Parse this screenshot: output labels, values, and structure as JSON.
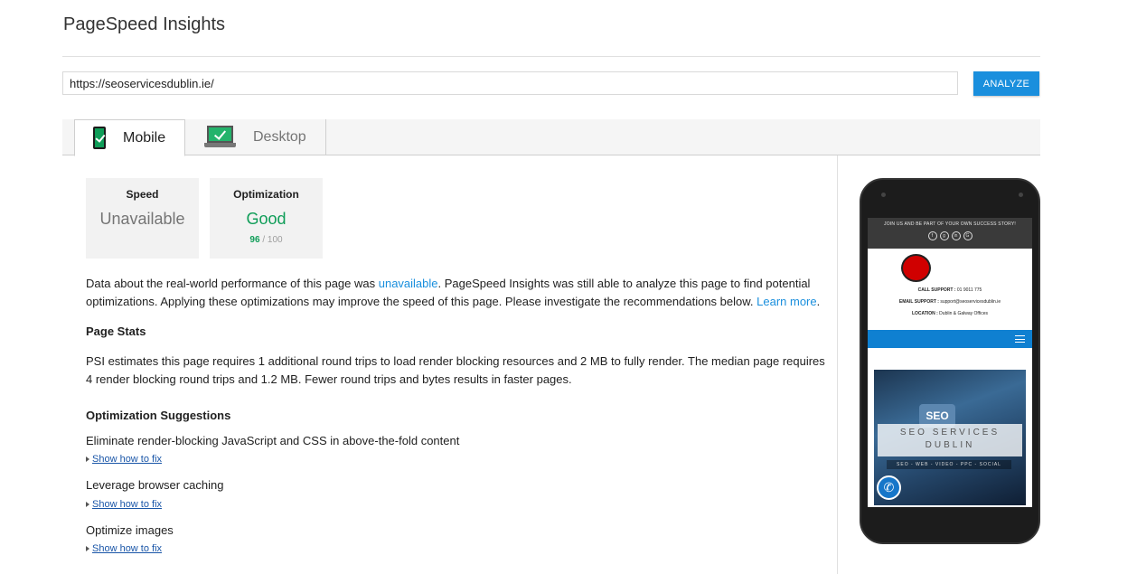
{
  "app": {
    "title": "PageSpeed Insights"
  },
  "search": {
    "url_value": "https://seoservicesdublin.ie/",
    "analyze_label": "ANALYZE"
  },
  "tabs": [
    {
      "label": "Mobile",
      "icon": "mobile-phone-check-icon",
      "active": true
    },
    {
      "label": "Desktop",
      "icon": "laptop-check-icon",
      "active": false
    }
  ],
  "scores": {
    "speed": {
      "title": "Speed",
      "value": "Unavailable"
    },
    "optimization": {
      "title": "Optimization",
      "value": "Good",
      "score": "96",
      "max": "/ 100"
    }
  },
  "summary": {
    "part1": "Data about the real-world performance of this page was ",
    "link_unavailable": "unavailable",
    "part2": ". PageSpeed Insights was still able to analyze this page to find potential optimizations. Applying these optimizations may improve the speed of this page. Please investigate the recommendations below. ",
    "link_learn_more": "Learn more",
    "part3": "."
  },
  "page_stats": {
    "heading": "Page Stats",
    "text": "PSI estimates this page requires 1 additional round trips to load render blocking resources and 2 MB to fully render. The median page requires 4 render blocking round trips and 1.2 MB. Fewer round trips and bytes results in faster pages."
  },
  "suggestions": {
    "heading": "Optimization Suggestions",
    "items": [
      {
        "title": "Eliminate render-blocking JavaScript and CSS in above-the-fold content",
        "link": "Show how to fix"
      },
      {
        "title": "Leverage browser caching",
        "link": "Show how to fix"
      },
      {
        "title": "Optimize images",
        "link": "Show how to fix"
      }
    ]
  },
  "preview": {
    "topbar_text": "JOIN US AND BE PART OF YOUR OWN SUCCESS STORY!",
    "social_icons": [
      "facebook-icon",
      "google-plus-icon",
      "linkedin-icon",
      "google-icon"
    ],
    "call_label": "CALL SUPPORT :",
    "call_value": "01 9011 775",
    "email_label": "EMAIL SUPPORT :",
    "email_value": "support@seoservicesdublin.ie",
    "location_label": "LOCATION :",
    "location_value": "Dublin & Galway Offices",
    "hero_badge": "SEO",
    "hero_line1": "SEO SERVICES",
    "hero_line2": "DUBLIN",
    "hero_strip": "SEO - WEB - VIDEO - PPC - SOCIAL"
  },
  "colors": {
    "accent_blue": "#1a8fdd",
    "good_green": "#0f9d58",
    "link_blue": "#1a56a8"
  }
}
